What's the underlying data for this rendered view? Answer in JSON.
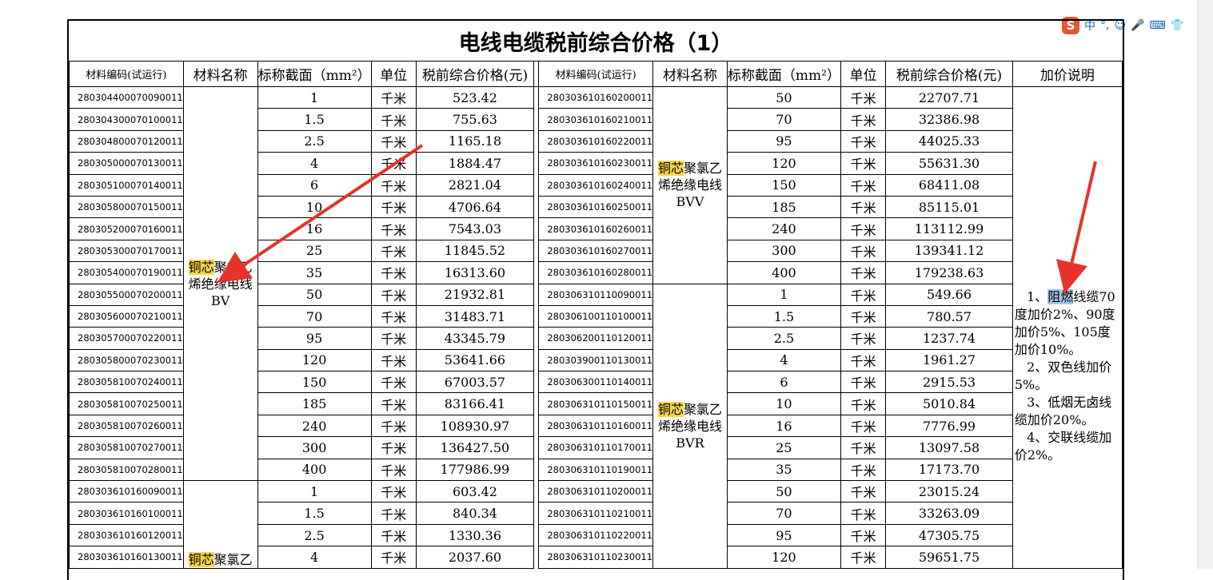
{
  "title": "电线电缆税前综合价格（1）",
  "headers": {
    "code": "材料编码(试运行)",
    "name": "材料名称",
    "section": "标称截面（mm²）",
    "unit": "单位",
    "price": "税前综合价格(元)",
    "note": "加价说明"
  },
  "left_groups": [
    {
      "name_hl": "铜芯",
      "name_rest": "聚氯乙烯绝缘电线",
      "model": "BV",
      "rows": [
        {
          "code": "280304400070090011",
          "section": "1",
          "unit": "千米",
          "price": "523.42"
        },
        {
          "code": "280304300070100011",
          "section": "1.5",
          "unit": "千米",
          "price": "755.63"
        },
        {
          "code": "280304800070120011",
          "section": "2.5",
          "unit": "千米",
          "price": "1165.18"
        },
        {
          "code": "280305000070130011",
          "section": "4",
          "unit": "千米",
          "price": "1884.47"
        },
        {
          "code": "280305100070140011",
          "section": "6",
          "unit": "千米",
          "price": "2821.04"
        },
        {
          "code": "280305800070150011",
          "section": "10",
          "unit": "千米",
          "price": "4706.64"
        },
        {
          "code": "280305200070160011",
          "section": "16",
          "unit": "千米",
          "price": "7543.03"
        },
        {
          "code": "280305300070170011",
          "section": "25",
          "unit": "千米",
          "price": "11845.52"
        },
        {
          "code": "280305400070190011",
          "section": "35",
          "unit": "千米",
          "price": "16313.60"
        },
        {
          "code": "280305500070200011",
          "section": "50",
          "unit": "千米",
          "price": "21932.81"
        },
        {
          "code": "280305600070210011",
          "section": "70",
          "unit": "千米",
          "price": "31483.71"
        },
        {
          "code": "280305700070220011",
          "section": "95",
          "unit": "千米",
          "price": "43345.79"
        },
        {
          "code": "280305800070230011",
          "section": "120",
          "unit": "千米",
          "price": "53641.66"
        },
        {
          "code": "280305810070240011",
          "section": "150",
          "unit": "千米",
          "price": "67003.57"
        },
        {
          "code": "280305810070250011",
          "section": "185",
          "unit": "千米",
          "price": "83166.41"
        },
        {
          "code": "280305810070260011",
          "section": "240",
          "unit": "千米",
          "price": "108930.97"
        },
        {
          "code": "280305810070270011",
          "section": "300",
          "unit": "千米",
          "price": "136427.50"
        },
        {
          "code": "280305810070280011",
          "section": "400",
          "unit": "千米",
          "price": "177986.99"
        }
      ]
    },
    {
      "name_hl": "铜芯",
      "name_rest": "聚氯乙",
      "model": "",
      "rows": [
        {
          "code": "280303610160090011",
          "section": "1",
          "unit": "千米",
          "price": "603.42"
        },
        {
          "code": "280303610160100011",
          "section": "1.5",
          "unit": "千米",
          "price": "840.34"
        },
        {
          "code": "280303610160120011",
          "section": "2.5",
          "unit": "千米",
          "price": "1330.36"
        },
        {
          "code": "280303610160130011",
          "section": "4",
          "unit": "千米",
          "price": "2037.60"
        }
      ]
    }
  ],
  "right_groups": [
    {
      "name_hl": "铜芯",
      "name_rest": "聚氯乙烯绝缘电线",
      "model": "BVV",
      "rows": [
        {
          "code": "280303610160200011",
          "section": "50",
          "unit": "千米",
          "price": "22707.71"
        },
        {
          "code": "280303610160210011",
          "section": "70",
          "unit": "千米",
          "price": "32386.98"
        },
        {
          "code": "280303610160220011",
          "section": "95",
          "unit": "千米",
          "price": "44025.33"
        },
        {
          "code": "280303610160230011",
          "section": "120",
          "unit": "千米",
          "price": "55631.30"
        },
        {
          "code": "280303610160240011",
          "section": "150",
          "unit": "千米",
          "price": "68411.08"
        },
        {
          "code": "280303610160250011",
          "section": "185",
          "unit": "千米",
          "price": "85115.01"
        },
        {
          "code": "280303610160260011",
          "section": "240",
          "unit": "千米",
          "price": "113112.99"
        },
        {
          "code": "280303610160270011",
          "section": "300",
          "unit": "千米",
          "price": "139341.12"
        },
        {
          "code": "280303610160280011",
          "section": "400",
          "unit": "千米",
          "price": "179238.63"
        }
      ]
    },
    {
      "name_hl": "铜芯",
      "name_rest": "聚氯乙烯绝缘电线",
      "model": "BVR",
      "rows": [
        {
          "code": "280306310110090011",
          "section": "1",
          "unit": "千米",
          "price": "549.66"
        },
        {
          "code": "280306100110100011",
          "section": "1.5",
          "unit": "千米",
          "price": "780.57"
        },
        {
          "code": "280306200110120011",
          "section": "2.5",
          "unit": "千米",
          "price": "1237.74"
        },
        {
          "code": "280303900110130011",
          "section": "4",
          "unit": "千米",
          "price": "1961.27"
        },
        {
          "code": "280306300110140011",
          "section": "6",
          "unit": "千米",
          "price": "2915.53"
        },
        {
          "code": "280306310110150011",
          "section": "10",
          "unit": "千米",
          "price": "5010.84"
        },
        {
          "code": "280306310110160011",
          "section": "16",
          "unit": "千米",
          "price": "7776.99"
        },
        {
          "code": "280306310110170011",
          "section": "25",
          "unit": "千米",
          "price": "13097.58"
        },
        {
          "code": "280306310110190011",
          "section": "35",
          "unit": "千米",
          "price": "17173.70"
        },
        {
          "code": "280306310110200011",
          "section": "50",
          "unit": "千米",
          "price": "23015.24"
        },
        {
          "code": "280306310110210011",
          "section": "70",
          "unit": "千米",
          "price": "33263.09"
        },
        {
          "code": "280306310110220011",
          "section": "95",
          "unit": "千米",
          "price": "47305.75"
        },
        {
          "code": "280306310110230011",
          "section": "120",
          "unit": "千米",
          "price": "59651.75"
        }
      ]
    }
  ],
  "note": {
    "p1_pre": "1、",
    "p1_hl": "阻燃",
    "p1_post": "线缆70度加价2%、90度加价5%、105度加价10%。",
    "p2": "2、双色线加价5%。",
    "p3": "3、低烟无卤线缆加价20%。",
    "p4": "4、交联线缆加价2%。"
  },
  "ime": {
    "logo": "S",
    "lang": "中",
    "punct": "°,",
    "icons": [
      "smiley-icon",
      "microphone-icon",
      "keyboard-icon",
      "shirt-icon"
    ]
  },
  "colors": {
    "name_highlight": "#f7d64a",
    "note_highlight": "#a9c7e8",
    "arrow": "#e8332a",
    "ime_logo": "#e8552e"
  }
}
